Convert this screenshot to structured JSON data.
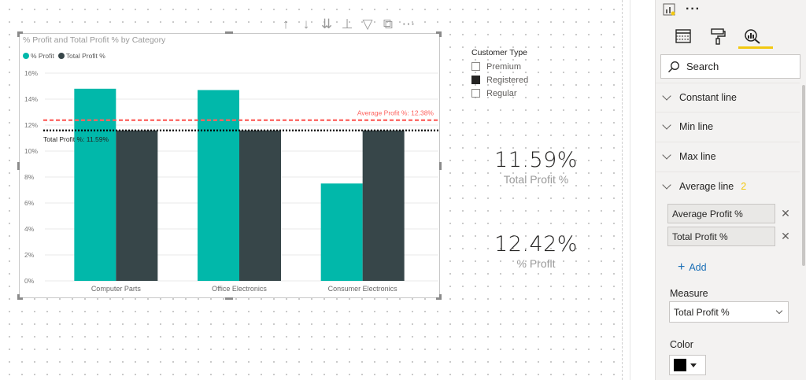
{
  "visual_toolbar": {
    "icons": [
      "drill-up-icon",
      "drill-down-icon",
      "expand-all-down-icon",
      "expand-hierarchy-icon",
      "filter-icon",
      "focus-mode-icon",
      "more-options-icon"
    ],
    "glyphs": [
      "↑",
      "↓",
      "⇊",
      "⊥",
      "▽",
      "⧉",
      "⋯"
    ]
  },
  "chart": {
    "title": "% Profit and Total Profit % by Category",
    "legend": [
      {
        "label": "% Profit",
        "color": "#01b8aa"
      },
      {
        "label": "Total Profit %",
        "color": "#374649"
      }
    ]
  },
  "chart_data": {
    "type": "bar",
    "title": "% Profit and Total Profit % by Category",
    "categories": [
      "Computer Parts",
      "Office Electronics",
      "Consumer Electronics"
    ],
    "series": [
      {
        "name": "% Profit",
        "color": "#01b8aa",
        "values": [
          14.8,
          14.7,
          7.5
        ]
      },
      {
        "name": "Total Profit %",
        "color": "#374649",
        "values": [
          11.59,
          11.59,
          11.59
        ]
      }
    ],
    "ylim": [
      0,
      16
    ],
    "yticks": [
      0,
      2,
      4,
      6,
      8,
      10,
      12,
      14,
      16
    ],
    "ytick_labels": [
      "0%",
      "2%",
      "4%",
      "6%",
      "8%",
      "10%",
      "12%",
      "14%",
      "16%"
    ],
    "reference_lines": [
      {
        "label": "Average Profit %: 12.38%",
        "value": 12.38,
        "color": "#fd625e",
        "style": "dashed"
      },
      {
        "label": "Total Profit %: 11.59%",
        "value": 11.59,
        "color": "#000000",
        "style": "dotted"
      }
    ],
    "grid": true
  },
  "slicer": {
    "title": "Customer Type",
    "items": [
      {
        "label": "Premium",
        "checked": false
      },
      {
        "label": "Registered",
        "checked": true
      },
      {
        "label": "Regular",
        "checked": false
      }
    ]
  },
  "kpis": {
    "total": {
      "value": "11.59%",
      "label": "Total Profit %"
    },
    "profit": {
      "value": "12.42%",
      "label": "% Profit"
    }
  },
  "pane": {
    "more_label": "···",
    "search_label": "Search",
    "sections": {
      "constant": "Constant line",
      "min": "Min line",
      "max": "Max line",
      "average": "Average line",
      "average_count": "2"
    },
    "lines": [
      "Average Profit %",
      "Total Profit %"
    ],
    "add_label": "Add",
    "measure_label": "Measure",
    "measure_value": "Total Profit %",
    "color_label": "Color",
    "color_value": "#000000"
  }
}
